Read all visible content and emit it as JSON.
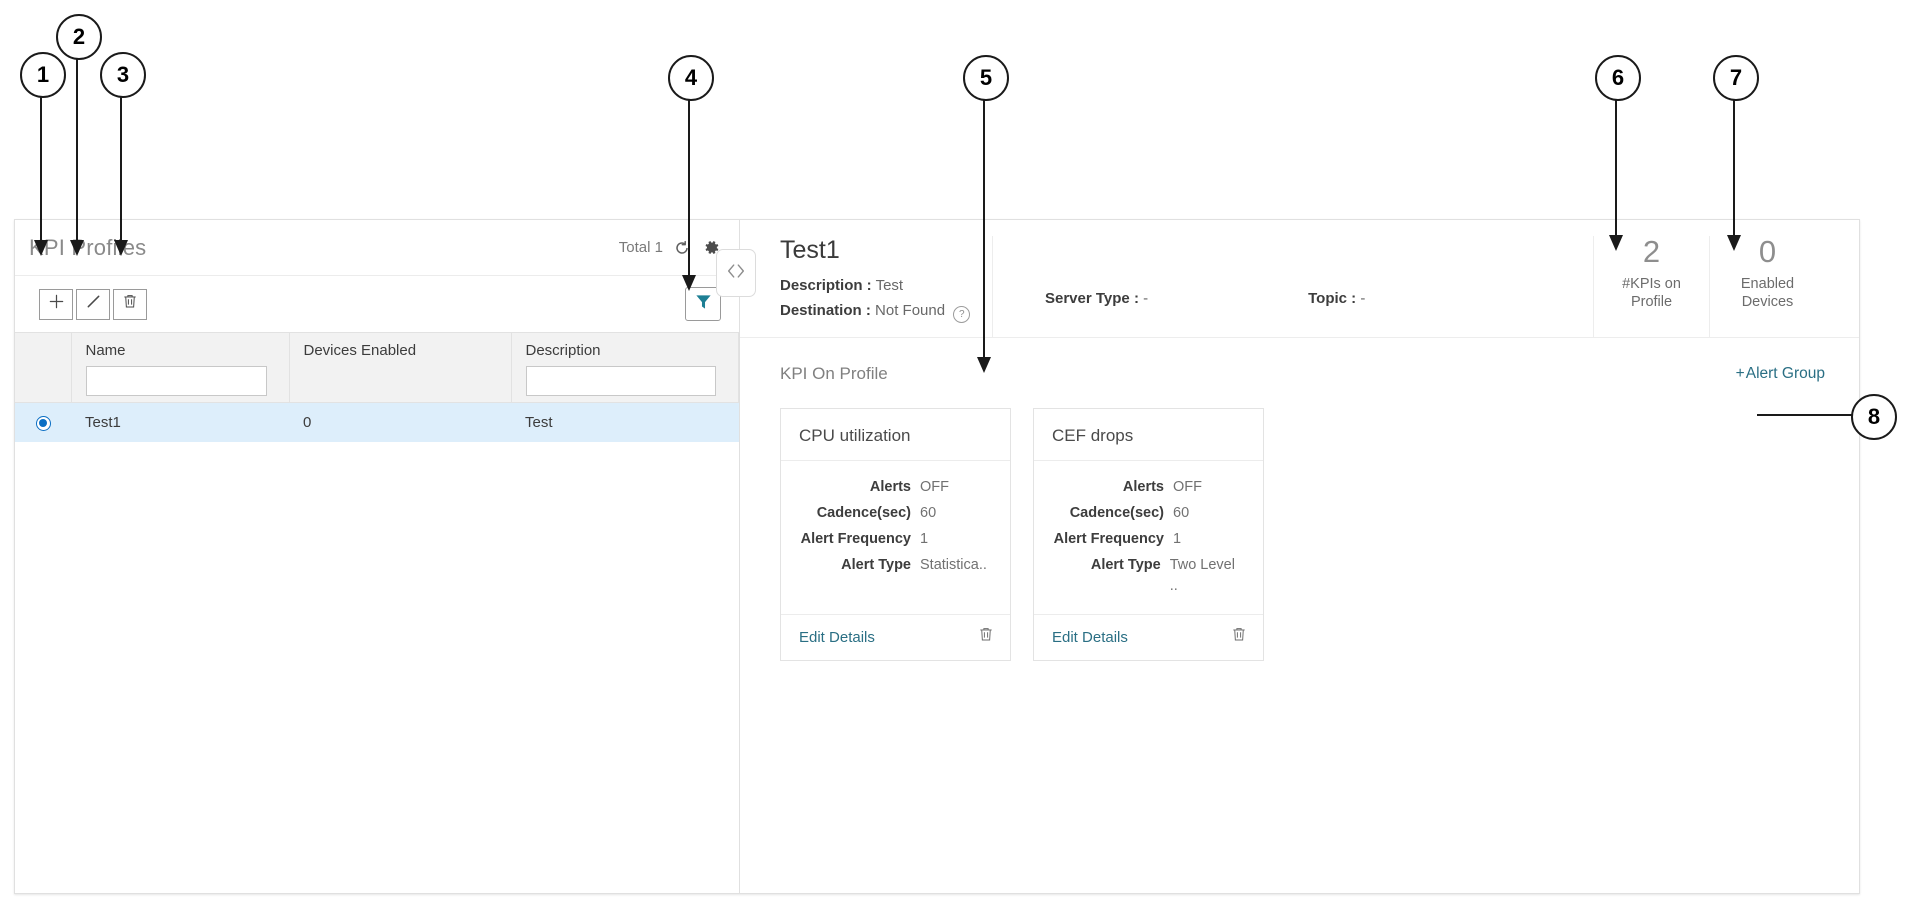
{
  "annotations": [
    {
      "id": "1",
      "label": "1"
    },
    {
      "id": "2",
      "label": "2"
    },
    {
      "id": "3",
      "label": "3"
    },
    {
      "id": "4",
      "label": "4"
    },
    {
      "id": "5",
      "label": "5"
    },
    {
      "id": "6",
      "label": "6"
    },
    {
      "id": "7",
      "label": "7"
    },
    {
      "id": "8",
      "label": "8"
    }
  ],
  "colors": {
    "accent_teal": "#2a6f84",
    "filter_teal": "#1d7f94",
    "radio_blue": "#0b6fc4",
    "row_selected": "#ddeefb",
    "muted_text": "#8a8a8a"
  },
  "left_panel": {
    "title": "KPI Profiles",
    "total_label": "Total 1",
    "refresh_icon": "refresh-icon",
    "settings_icon": "gear-icon",
    "toolbar": {
      "add_icon": "plus-icon",
      "edit_icon": "pencil-icon",
      "delete_icon": "trash-icon",
      "filter_icon": "filter-icon"
    },
    "table": {
      "columns": [
        "",
        "Name",
        "Devices Enabled",
        "Description"
      ],
      "filter_placeholders": [
        "",
        "",
        "",
        ""
      ],
      "filter_values": [
        "",
        "",
        "",
        ""
      ],
      "rows": [
        {
          "selected": true,
          "name": "Test1",
          "devices_enabled": "0",
          "description": "Test"
        }
      ]
    }
  },
  "right_panel": {
    "collapse_icon": "chevron-left-right-icon",
    "profile": {
      "name": "Test1",
      "description_label": "Description :",
      "description_value": "Test",
      "destination_label": "Destination :",
      "destination_value": "Not Found",
      "destination_help_icon": "question-circle-icon",
      "server_type_label": "Server Type :",
      "server_type_value": "-",
      "topic_label": "Topic :",
      "topic_value": "-"
    },
    "stats": [
      {
        "value": "2",
        "label": "#KPIs on Profile"
      },
      {
        "value": "0",
        "label": "Enabled Devices"
      }
    ],
    "kpi_section": {
      "title": "KPI On Profile",
      "alert_group_link": "Alert Group",
      "alert_group_plus": "+",
      "cards": [
        {
          "title": "CPU utilization",
          "properties": [
            {
              "key": "Alerts",
              "value": "OFF"
            },
            {
              "key": "Cadence(sec)",
              "value": "60"
            },
            {
              "key": "Alert Frequency",
              "value": "1"
            },
            {
              "key": "Alert Type",
              "value": "Statistica.."
            }
          ],
          "edit_link": "Edit Details",
          "delete_icon": "trash-icon"
        },
        {
          "title": "CEF drops",
          "properties": [
            {
              "key": "Alerts",
              "value": "OFF"
            },
            {
              "key": "Cadence(sec)",
              "value": "60"
            },
            {
              "key": "Alert Frequency",
              "value": "1"
            },
            {
              "key": "Alert Type",
              "value": "Two Level .."
            }
          ],
          "edit_link": "Edit Details",
          "delete_icon": "trash-icon"
        }
      ]
    }
  }
}
